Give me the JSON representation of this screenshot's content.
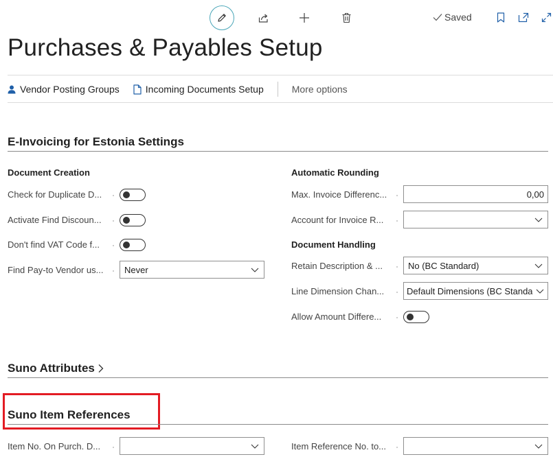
{
  "toolbar": {
    "edit": "pencil-icon",
    "share": "share-icon",
    "new": "plus-icon",
    "delete": "trash-icon",
    "saved_label": "Saved",
    "bookmark": "bookmark-icon",
    "open_new_window": "open-new-window-icon",
    "expand": "expand-icon"
  },
  "page": {
    "title": "Purchases & Payables Setup"
  },
  "actions": {
    "vendor_posting_groups": "Vendor Posting Groups",
    "incoming_documents_setup": "Incoming Documents Setup",
    "more_options": "More options"
  },
  "einvoicing": {
    "title": "E-Invoicing for Estonia Settings",
    "document_creation": {
      "title": "Document Creation",
      "check_duplicate_label": "Check for Duplicate D...",
      "activate_find_discount_label": "Activate Find Discoun...",
      "dont_find_vat_label": "Don't find VAT Code f...",
      "find_pay_to_label": "Find Pay-to Vendor us...",
      "find_pay_to_value": "Never"
    },
    "automatic_rounding": {
      "title": "Automatic Rounding",
      "max_invoice_diff_label": "Max. Invoice Differenc...",
      "max_invoice_diff_value": "0,00",
      "account_invoice_label": "Account for Invoice R...",
      "account_invoice_value": ""
    },
    "document_handling": {
      "title": "Document Handling",
      "retain_desc_label": "Retain Description & ...",
      "retain_desc_value": "No (BC Standard)",
      "line_dim_label": "Line Dimension Chan...",
      "line_dim_value": "Default Dimensions (BC Standard)",
      "allow_amount_label": "Allow Amount Differe..."
    }
  },
  "suno_attributes": {
    "title": "Suno Attributes"
  },
  "suno_item_refs": {
    "title": "Suno Item References",
    "item_no_label": "Item No. On Purch. D...",
    "item_no_value": "",
    "item_ref_label": "Item Reference No. to...",
    "item_ref_value": ""
  },
  "colors": {
    "accent": "#4aa6b8",
    "highlight": "#e31b23",
    "person_icon": "#1f5fa8"
  }
}
